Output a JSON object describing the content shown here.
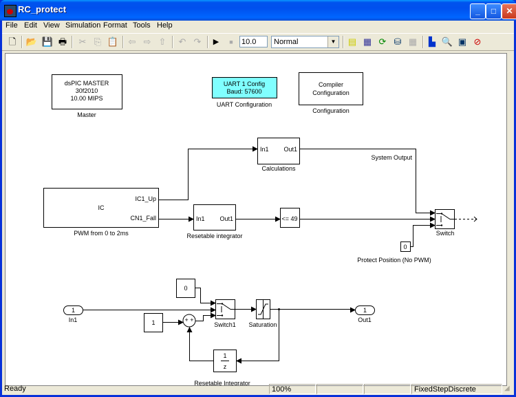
{
  "window": {
    "title": "RC_protect"
  },
  "menu": [
    "File",
    "Edit",
    "View",
    "Simulation",
    "Format",
    "Tools",
    "Help"
  ],
  "toolbar": {
    "stop_time": "10.0",
    "sim_mode": "Normal",
    "icons": [
      "new-icon",
      "open-icon",
      "save-icon",
      "print-icon",
      "cut-icon",
      "copy-icon",
      "paste-icon",
      "back-icon",
      "forward-icon",
      "up-icon",
      "undo-icon",
      "redo-icon",
      "run-icon",
      "stop-icon",
      "library-browser-icon",
      "build-icon",
      "refresh-icon",
      "debug-icon",
      "profile-icon",
      "model-explorer-icon",
      "model-advisor-icon",
      "config-icon",
      "debugger-icon"
    ]
  },
  "blocks": {
    "master": {
      "lines": [
        "dsPIC MASTER",
        "30f2010",
        "10.00 MIPS"
      ],
      "label": "Master"
    },
    "uart": {
      "lines": [
        "UART 1 Config",
        "Baud: 57600"
      ],
      "label": "UART Configuration",
      "fill": "#80ffff"
    },
    "compiler": {
      "lines": [
        "Compiler",
        "Configuration"
      ],
      "label": "Configuration"
    },
    "calculations": {
      "in": "In1",
      "out": "Out1",
      "label": "Calculations"
    },
    "ic": {
      "center": "IC",
      "ports": [
        "IC1_Up",
        "CN1_Fall"
      ],
      "label": "PWM from 0 to 2ms"
    },
    "reset_int": {
      "in": "In1",
      "out": "Out1",
      "label": "Resetable integrator"
    },
    "compare": {
      "text": "<= 49"
    },
    "switch": {
      "label": "Switch"
    },
    "system_output_label": "System Output",
    "protect": {
      "value": "0",
      "label": "Protect Position (No PWM)"
    },
    "const0": {
      "value": "0"
    },
    "const1": {
      "value": "1"
    },
    "in1": {
      "num": "1",
      "label": "In1"
    },
    "sum": {
      "signs": "+ +"
    },
    "switch1": {
      "label": "Switch1"
    },
    "saturation": {
      "label": "Saturation"
    },
    "out1": {
      "num": "1",
      "label": "Out1"
    },
    "delay": {
      "num": "1",
      "den": "z"
    },
    "subsystem_label": "Resetable Integrator"
  },
  "status": {
    "left": "Ready",
    "zoom": "100%",
    "cell3": "",
    "cell4": "",
    "solver": "FixedStepDiscrete"
  }
}
